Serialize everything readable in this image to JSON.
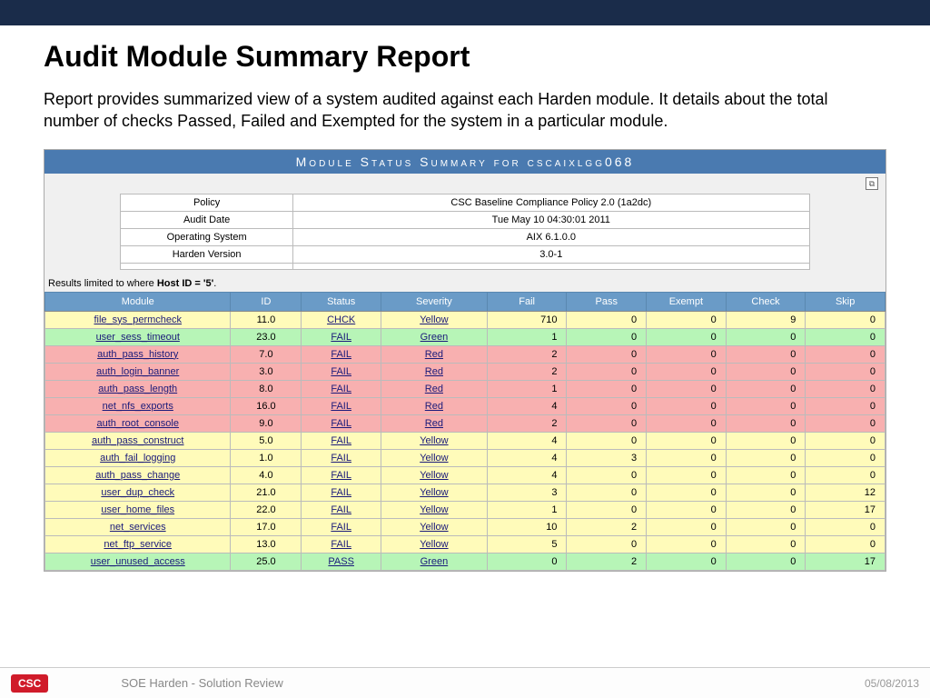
{
  "header": {
    "title": "Audit Module Summary Report",
    "description": "Report provides summarized view of a system audited against each Harden module. It details about the total number of checks Passed, Failed and Exempted for the system in a particular module."
  },
  "banner": "Module Status Summary for cscaixlgg068",
  "meta": [
    {
      "label": "Policy",
      "value": "CSC Baseline Compliance Policy 2.0 (1a2dc)"
    },
    {
      "label": "Audit Date",
      "value": "Tue May 10 04:30:01 2011"
    },
    {
      "label": "Operating System",
      "value": "AIX 6.1.0.0"
    },
    {
      "label": "Harden Version",
      "value": "3.0-1"
    },
    {
      "label": "",
      "value": ""
    }
  ],
  "results_note_prefix": "Results limited to where ",
  "results_note_bold": "Host ID = '5'",
  "results_note_suffix": ".",
  "grid": {
    "headers": [
      "Module",
      "ID",
      "Status",
      "Severity",
      "Fail",
      "Pass",
      "Exempt",
      "Check",
      "Skip"
    ],
    "rows": [
      {
        "sev": "yellow",
        "module": "file_sys_permcheck",
        "id": "11.0",
        "status": "CHCK",
        "severity": "Yellow",
        "fail": 710,
        "pass": 0,
        "exempt": 0,
        "check": 9,
        "skip": 0
      },
      {
        "sev": "green",
        "module": "user_sess_timeout",
        "id": "23.0",
        "status": "FAIL",
        "severity": "Green",
        "fail": 1,
        "pass": 0,
        "exempt": 0,
        "check": 0,
        "skip": 0
      },
      {
        "sev": "red",
        "module": "auth_pass_history",
        "id": "7.0",
        "status": "FAIL",
        "severity": "Red",
        "fail": 2,
        "pass": 0,
        "exempt": 0,
        "check": 0,
        "skip": 0
      },
      {
        "sev": "red",
        "module": "auth_login_banner",
        "id": "3.0",
        "status": "FAIL",
        "severity": "Red",
        "fail": 2,
        "pass": 0,
        "exempt": 0,
        "check": 0,
        "skip": 0
      },
      {
        "sev": "red",
        "module": "auth_pass_length",
        "id": "8.0",
        "status": "FAIL",
        "severity": "Red",
        "fail": 1,
        "pass": 0,
        "exempt": 0,
        "check": 0,
        "skip": 0
      },
      {
        "sev": "red",
        "module": "net_nfs_exports",
        "id": "16.0",
        "status": "FAIL",
        "severity": "Red",
        "fail": 4,
        "pass": 0,
        "exempt": 0,
        "check": 0,
        "skip": 0
      },
      {
        "sev": "red",
        "module": "auth_root_console",
        "id": "9.0",
        "status": "FAIL",
        "severity": "Red",
        "fail": 2,
        "pass": 0,
        "exempt": 0,
        "check": 0,
        "skip": 0
      },
      {
        "sev": "yellow",
        "module": "auth_pass_construct",
        "id": "5.0",
        "status": "FAIL",
        "severity": "Yellow",
        "fail": 4,
        "pass": 0,
        "exempt": 0,
        "check": 0,
        "skip": 0
      },
      {
        "sev": "yellow",
        "module": "auth_fail_logging",
        "id": "1.0",
        "status": "FAIL",
        "severity": "Yellow",
        "fail": 4,
        "pass": 3,
        "exempt": 0,
        "check": 0,
        "skip": 0
      },
      {
        "sev": "yellow",
        "module": "auth_pass_change",
        "id": "4.0",
        "status": "FAIL",
        "severity": "Yellow",
        "fail": 4,
        "pass": 0,
        "exempt": 0,
        "check": 0,
        "skip": 0
      },
      {
        "sev": "yellow",
        "module": "user_dup_check",
        "id": "21.0",
        "status": "FAIL",
        "severity": "Yellow",
        "fail": 3,
        "pass": 0,
        "exempt": 0,
        "check": 0,
        "skip": 12
      },
      {
        "sev": "yellow",
        "module": "user_home_files",
        "id": "22.0",
        "status": "FAIL",
        "severity": "Yellow",
        "fail": 1,
        "pass": 0,
        "exempt": 0,
        "check": 0,
        "skip": 17
      },
      {
        "sev": "yellow",
        "module": "net_services",
        "id": "17.0",
        "status": "FAIL",
        "severity": "Yellow",
        "fail": 10,
        "pass": 2,
        "exempt": 0,
        "check": 0,
        "skip": 0
      },
      {
        "sev": "yellow",
        "module": "net_ftp_service",
        "id": "13.0",
        "status": "FAIL",
        "severity": "Yellow",
        "fail": 5,
        "pass": 0,
        "exempt": 0,
        "check": 0,
        "skip": 0
      },
      {
        "sev": "green",
        "module": "user_unused_access",
        "id": "25.0",
        "status": "PASS",
        "severity": "Green",
        "fail": 0,
        "pass": 2,
        "exempt": 0,
        "check": 0,
        "skip": 17
      }
    ]
  },
  "footer": {
    "logo": "CSC",
    "title": "SOE Harden -  Solution Review",
    "date": "05/08/2013"
  }
}
